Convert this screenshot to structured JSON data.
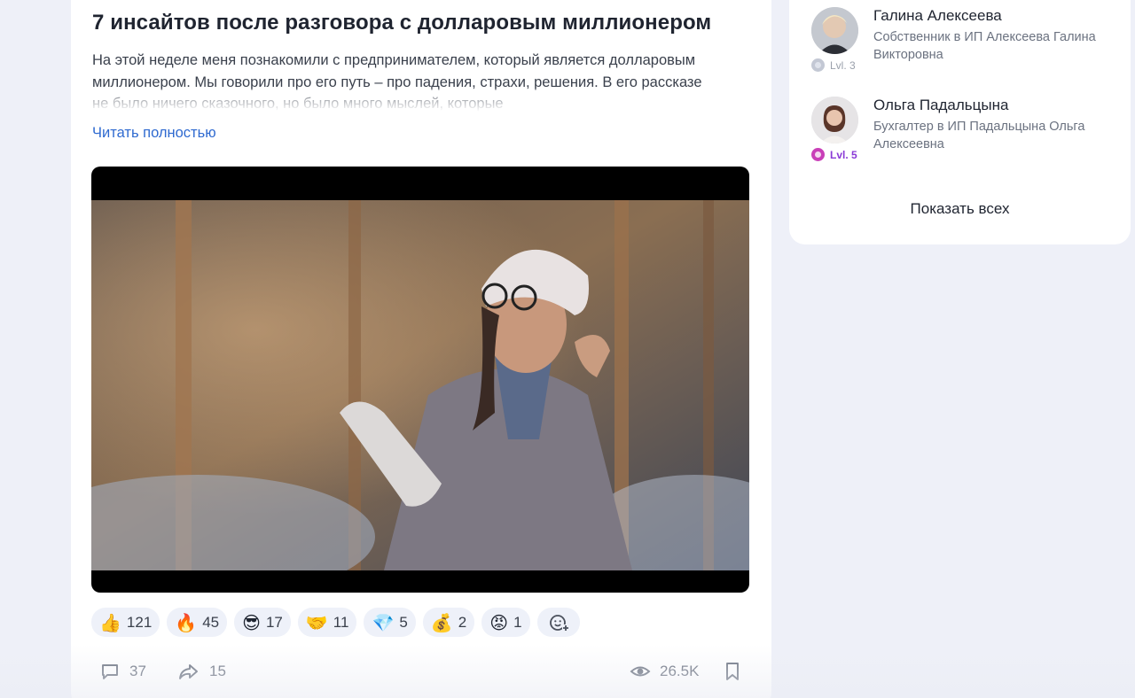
{
  "post": {
    "title": "7 инсайтов после разговора с долларовым миллионером",
    "excerpt": "На этой неделе меня познакомили с предпринимателем, который является долларовым миллионером. Мы говорили про его путь – про падения, страхи, решения. В его рассказе не было ничего сказочного, но было много мыслей, которые",
    "read_more": "Читать полностью"
  },
  "reactions": [
    {
      "icon": "thumbs-up-icon",
      "emoji": "👍",
      "count": "121"
    },
    {
      "icon": "fire-icon",
      "emoji": "🔥",
      "count": "45"
    },
    {
      "icon": "sunglasses-face-icon",
      "emoji": "😎",
      "count": "17"
    },
    {
      "icon": "handshake-icon",
      "emoji": "🤝",
      "count": "11"
    },
    {
      "icon": "diamond-icon",
      "emoji": "💎",
      "count": "5"
    },
    {
      "icon": "money-bag-icon",
      "emoji": "💰",
      "count": "2"
    },
    {
      "icon": "angry-face-icon",
      "emoji": "😡",
      "count": "1"
    }
  ],
  "footer": {
    "comments": "37",
    "shares": "15",
    "views": "26.5K"
  },
  "side": {
    "people": [
      {
        "name": "Галина Алексеева",
        "role": "Собственник в ИП Алексеева Галина Викторовна",
        "level": "Lvl. 3",
        "level_color": "#b8bcc6"
      },
      {
        "name": "Ольга Падальцына",
        "role": "Бухгалтер в ИП Падальцына Ольга Алексеевна",
        "level": "Lvl. 5",
        "level_color": "#8a3ad6"
      }
    ],
    "show_all": "Показать всех"
  },
  "colors": {
    "accent_link": "#2f6ad0",
    "page_bg": "#eef0f8",
    "reaction_bg": "#eef1f9"
  }
}
